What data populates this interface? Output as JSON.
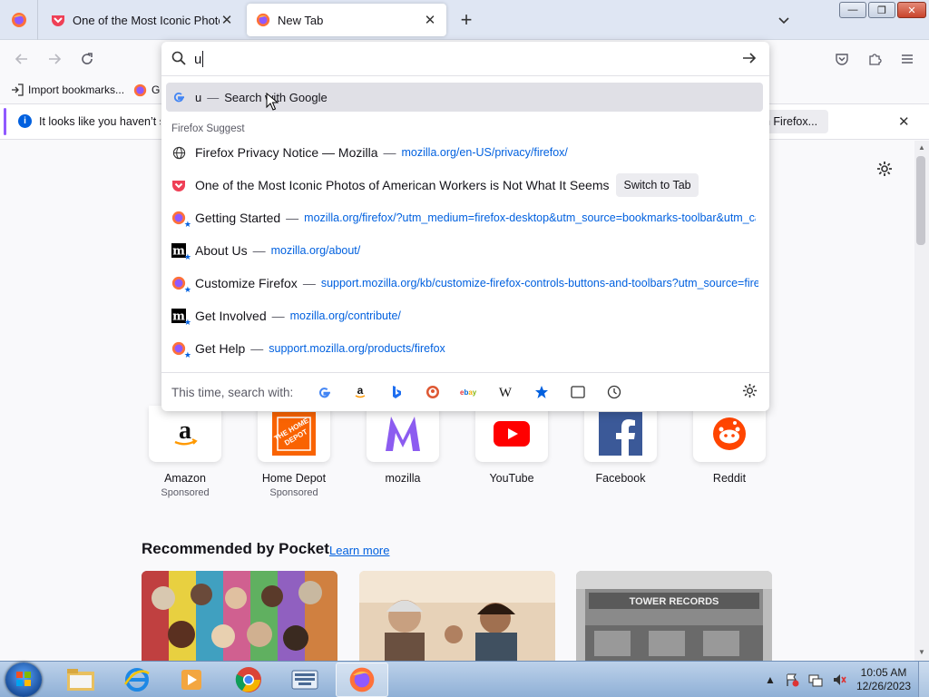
{
  "tabs": [
    {
      "label": "One of the Most Iconic Photos of American Workers is Not What It Seems",
      "icon": "pocket-icon"
    },
    {
      "label": "New Tab",
      "icon": "firefox-icon",
      "active": true
    }
  ],
  "window": {
    "min": "—",
    "max": "❐",
    "close": "✕"
  },
  "bookmarks": [
    {
      "label": "Import bookmarks...",
      "icon": "import-icon"
    },
    {
      "label": "G",
      "icon": "firefox-icon"
    }
  ],
  "notification": {
    "text": "It looks like you haven’t s",
    "button": "h Firefox..."
  },
  "urlbar": {
    "value": "u",
    "heuristic": {
      "query": "u",
      "dash": "—",
      "action": "Search with Google"
    },
    "section_label": "Firefox Suggest",
    "results": [
      {
        "title": "Firefox Privacy Notice — Mozilla",
        "dash": "—",
        "url": "mozilla.org/en-US/privacy/firefox/",
        "icon": "globe-icon"
      },
      {
        "title": "One of the Most Iconic Photos of American Workers is Not What It Seems",
        "switch": "Switch to Tab",
        "icon": "pocket-icon"
      },
      {
        "title": "Getting Started",
        "dash": "—",
        "url": "mozilla.org/firefox/?utm_medium=firefox-desktop&utm_source=bookmarks-toolbar&utm_ca",
        "icon": "firefox-bookmark-icon"
      },
      {
        "title": "About Us",
        "dash": "—",
        "url": "mozilla.org/about/",
        "icon": "mozilla-m-icon"
      },
      {
        "title": "Customize Firefox",
        "dash": "—",
        "url": "support.mozilla.org/kb/customize-firefox-controls-buttons-and-toolbars?utm_source=firef",
        "icon": "firefox-bookmark-icon"
      },
      {
        "title": "Get Involved",
        "dash": "—",
        "url": "mozilla.org/contribute/",
        "icon": "mozilla-m-icon"
      },
      {
        "title": "Get Help",
        "dash": "—",
        "url": "support.mozilla.org/products/firefox",
        "icon": "firefox-bookmark-icon"
      }
    ],
    "oneoff_label": "This time, search with:",
    "engines": [
      "google-icon",
      "amazon-icon",
      "bing-icon",
      "duckduckgo-icon",
      "ebay-icon",
      "wikipedia-icon",
      "bookmarks-star-icon",
      "tabs-icon",
      "history-icon"
    ]
  },
  "shortcuts": [
    {
      "name": "Amazon",
      "sponsored": "Sponsored"
    },
    {
      "name": "Home Depot",
      "sponsored": "Sponsored"
    },
    {
      "name": "mozilla",
      "sponsored": ""
    },
    {
      "name": "YouTube",
      "sponsored": ""
    },
    {
      "name": "Facebook",
      "sponsored": ""
    },
    {
      "name": "Reddit",
      "sponsored": ""
    }
  ],
  "pocket": {
    "heading": "Recommended by Pocket",
    "link": "Learn more"
  },
  "clock": {
    "time": "10:05 AM",
    "date": "12/26/2023"
  },
  "colors": {
    "accent": "#0060df",
    "notif_accent": "#9059ff",
    "tabstrip": "#dfe6f3"
  }
}
